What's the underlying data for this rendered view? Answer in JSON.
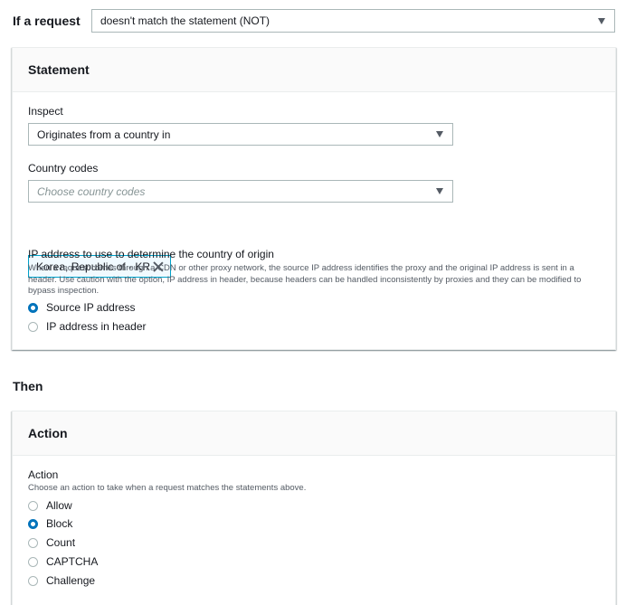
{
  "condition": {
    "label": "If a request",
    "selected": "doesn't match the statement (NOT)",
    "icon": "caret-down-icon"
  },
  "statement": {
    "title": "Statement",
    "inspect": {
      "label": "Inspect",
      "selected": "Originates from a country in"
    },
    "country_codes": {
      "label": "Country codes",
      "placeholder": "Choose country codes",
      "tokens": [
        "Korea, Republic of - KR"
      ]
    },
    "ip_source": {
      "label": "IP address to use to determine the country of origin",
      "description": "When a request comes through a CDN or other proxy network, the source IP address identifies the proxy and the original IP address is sent in a header. Use caution with the option, IP address in header, because headers can be handled inconsistently by proxies and they can be modified to bypass inspection.",
      "options": [
        "Source IP address",
        "IP address in header"
      ],
      "selected_index": 0
    }
  },
  "then_label": "Then",
  "action_panel": {
    "title": "Action",
    "label": "Action",
    "description": "Choose an action to take when a request matches the statements above.",
    "options": [
      "Allow",
      "Block",
      "Count",
      "CAPTCHA",
      "Challenge"
    ],
    "selected_index": 1
  },
  "colors": {
    "accent": "#0073bb",
    "token_border": "#00a1c9",
    "token_bg": "#f1faff",
    "border": "#aab7b8"
  }
}
